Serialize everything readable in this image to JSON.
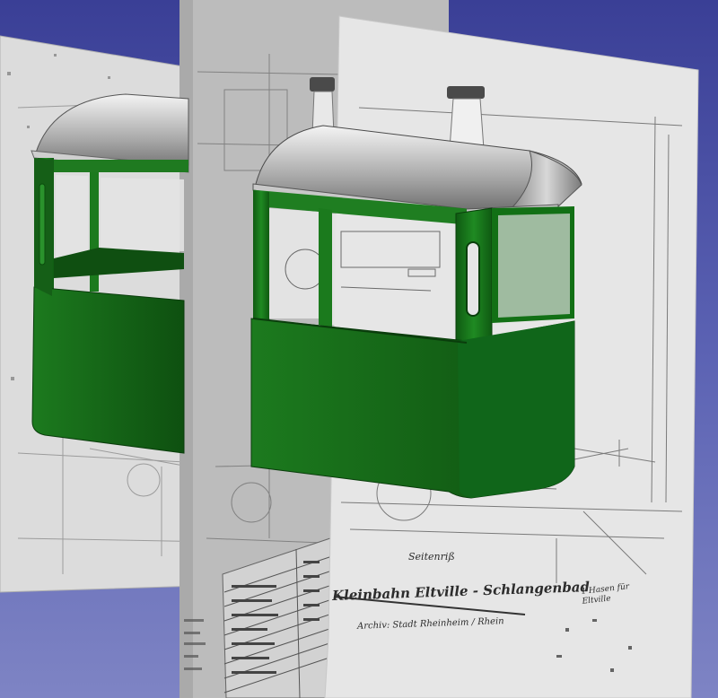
{
  "scene": {
    "background_top": "#3a3f96",
    "background_bottom": "#7e84c4",
    "cab_color": "#1f7a1f",
    "roof_color": "#9a9a9a",
    "sheet_color": "#d9d9d9"
  },
  "drawing": {
    "title": "Kleinbahn Eltville - Schlangenbad",
    "archive_note": "Archiv: Stadt Rheinheim / Rhein",
    "view_label": "Seitenriß",
    "note": "1 Hasen für\nEltville"
  }
}
